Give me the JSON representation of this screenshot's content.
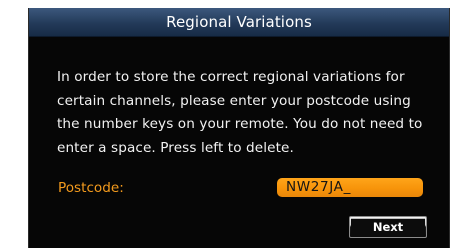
{
  "dialog": {
    "title": "Regional Variations",
    "message": "In order to store the correct regional variations for certain channels, please enter your postcode using the number keys on your remote. You do not need to enter a space. Press left to delete.",
    "postcode_label": "Postcode:",
    "postcode_value": "NW27JA_",
    "next_label": "Next"
  },
  "colors": {
    "title_bar": "#233a59",
    "background": "#060606",
    "label_orange": "#f39a1d",
    "input_orange": "#f7940a"
  }
}
